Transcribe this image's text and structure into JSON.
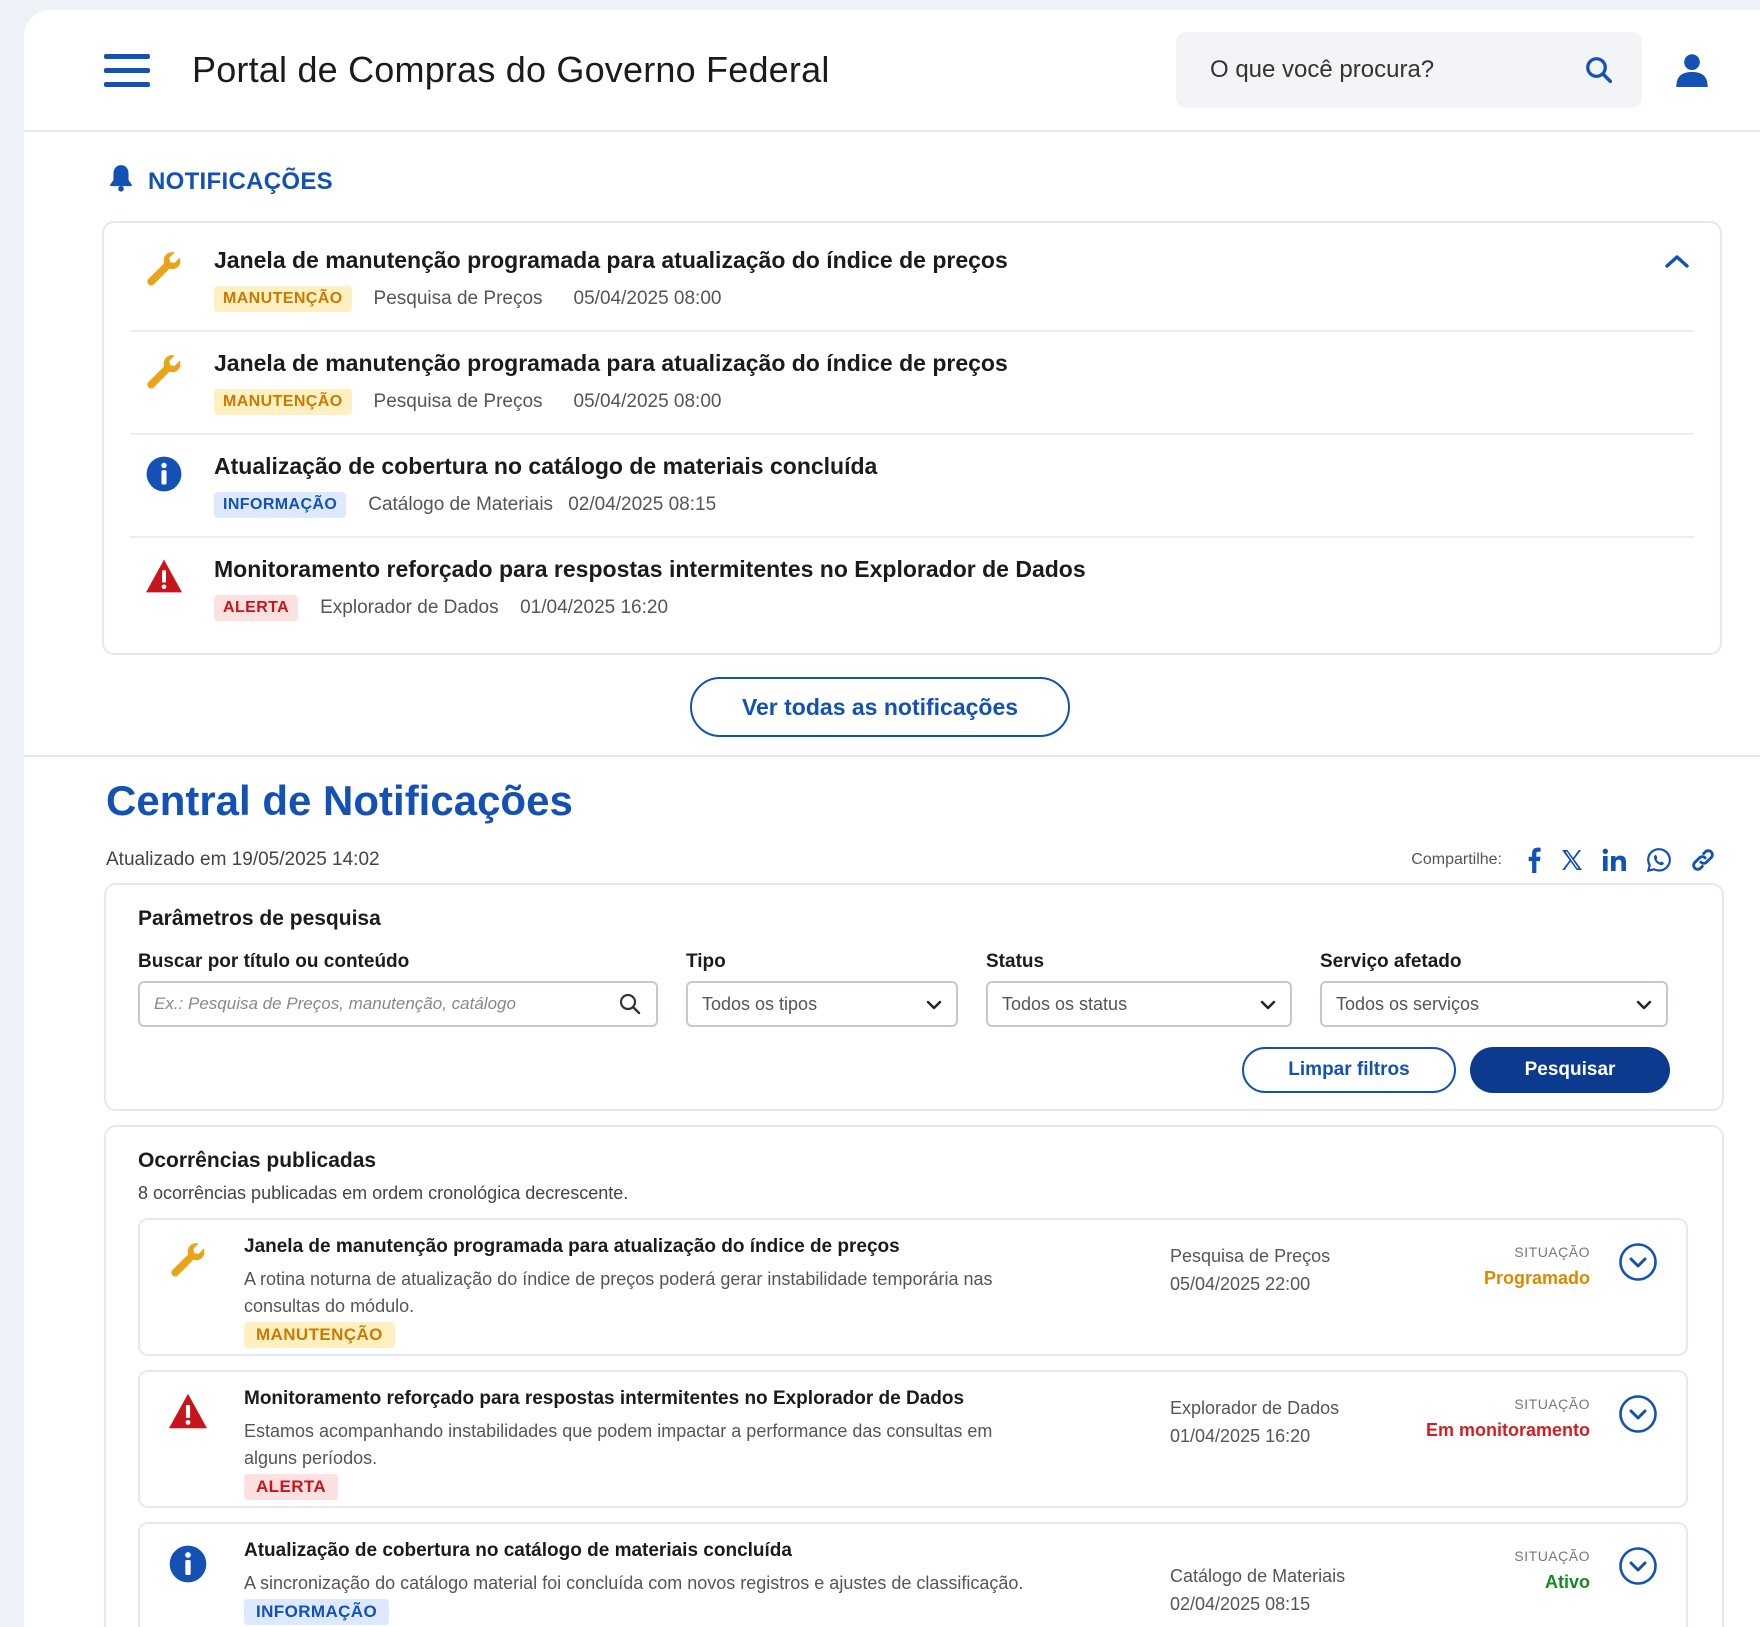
{
  "header": {
    "title": "Portal de Compras do Governo Federal",
    "search_placeholder": "O que você procura?"
  },
  "notifications": {
    "heading": "NOTIFICAÇÕES",
    "items": [
      {
        "icon": "wrench-icon",
        "title": "Janela de manutenção programada para atualização do índice de preços",
        "badge": "MANUTENÇÃO",
        "service": "Pesquisa de Preços",
        "datetime": "05/04/2025 08:00"
      },
      {
        "icon": "wrench-icon",
        "title": "Janela de manutenção programada para atualização do índice de preços",
        "badge": "MANUTENÇÃO",
        "service": "Pesquisa de Preços",
        "datetime": "05/04/2025 08:00"
      },
      {
        "icon": "info-icon",
        "title": "Atualização de cobertura no catálogo de materiais concluída",
        "badge": "INFORMAÇÃO",
        "service": "Catálogo de Materiais",
        "datetime": "02/04/2025 08:15"
      },
      {
        "icon": "warning-icon",
        "title": "Monitoramento reforçado para respostas intermitentes no Explorador de Dados",
        "badge": "ALERTA",
        "service": "Explorador de Dados",
        "datetime": "01/04/2025 16:20"
      }
    ],
    "see_all_label": "Ver todas as notificações"
  },
  "central": {
    "title": "Central de Notificações",
    "updated": "Atualizado em 19/05/2025 14:02",
    "share_label": "Compartilhe:",
    "filters": {
      "title": "Parâmetros de pesquisa",
      "search_label": "Buscar por título ou conteúdo",
      "search_placeholder": "Ex.: Pesquisa de Preços, manutenção, catálogo",
      "tipo_label": "Tipo",
      "tipo_value": "Todos os tipos",
      "status_label": "Status",
      "status_value": "Todos os status",
      "servico_label": "Serviço afetado",
      "servico_value": "Todos os serviços",
      "clear_label": "Limpar filtros",
      "search_button": "Pesquisar"
    },
    "occurrences": {
      "title": "Ocorrências publicadas",
      "subtitle": "8 ocorrências publicadas em ordem cronológica decrescente.",
      "situacao_label": "SITUAÇÃO",
      "items": [
        {
          "icon": "wrench-icon",
          "title": "Janela de manutenção programada para atualização do índice de preços",
          "description": "A rotina noturna de atualização do índice de preços poderá gerar instabilidade temporária nas consultas do módulo.",
          "badge": "MANUTENÇÃO",
          "service": "Pesquisa de Preços",
          "datetime": "05/04/2025 22:00",
          "status": "Programado"
        },
        {
          "icon": "warning-icon",
          "title": "Monitoramento reforçado para respostas intermitentes no Explorador de Dados",
          "description": "Estamos acompanhando instabilidades que podem impactar a performance das consultas em alguns períodos.",
          "badge": "ALERTA",
          "service": "Explorador de Dados",
          "datetime": "01/04/2025 16:20",
          "status": "Em monitoramento"
        },
        {
          "icon": "info-icon",
          "title": "Atualização de cobertura no catálogo de materiais concluída",
          "description": "A sincronização do catálogo material foi concluída com novos registros e ajustes de classificação.",
          "badge": "INFORMAÇÃO",
          "service": "Catálogo de Materiais",
          "datetime": "02/04/2025 08:15",
          "status": "Ativo"
        }
      ]
    }
  },
  "colors": {
    "primary": "#1351b4",
    "primary_dark": "#0c3a8f",
    "maintenance": "#e8a317",
    "alert": "#c4161c",
    "success": "#168821"
  }
}
